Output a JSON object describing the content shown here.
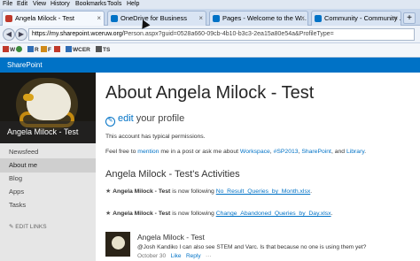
{
  "menu": [
    "File",
    "Edit",
    "View",
    "History",
    "Bookmarks",
    "Tools",
    "Help"
  ],
  "tabs": [
    {
      "label": "Angela Milock - Test",
      "active": true,
      "color": "#c0392b"
    },
    {
      "label": "OneDrive for Business",
      "active": false,
      "color": "#0072c6"
    },
    {
      "label": "Pages - Welcome to the W...",
      "active": false,
      "color": "#0072c6"
    },
    {
      "label": "Community - Community ...",
      "active": false,
      "color": "#0072c6"
    }
  ],
  "newtab_label": "+",
  "url_host": "https://my.sharepoint.wceruw.org/",
  "url_path": "Person.aspx?guid=0528a660-09cb-4b10-b3c3-2ea15a80e54a&ProfileType=",
  "bookmarks": [
    "W",
    "R",
    "F",
    "WCER",
    "TS"
  ],
  "suite_title": "SharePoint",
  "sidebar": {
    "name": "Angela Milock - Test",
    "items": [
      {
        "label": "Newsfeed",
        "selected": false
      },
      {
        "label": "About me",
        "selected": true
      },
      {
        "label": "Blog",
        "selected": false
      },
      {
        "label": "Apps",
        "selected": false
      },
      {
        "label": "Tasks",
        "selected": false
      }
    ],
    "edit_links": "EDIT LINKS"
  },
  "main": {
    "title": "About Angela Milock - Test",
    "edit_link": "edit",
    "edit_suffix": " your profile",
    "permissions": "This account has typical permissions.",
    "mention_pre": "Feel free to ",
    "mention_link": "mention",
    "mention_mid": " me in a post or ask me about ",
    "topic1": "Workspace",
    "topic2": "#SP2013",
    "topic3": "SharePoint",
    "and_text": ", and ",
    "topic4": "Library",
    "activities_heading": "Angela Milock - Test's Activities",
    "activities": [
      {
        "who": "Angela Milock - Test",
        "verb": " is now following ",
        "target": "No_Result_Queries_by_Month.xlsx",
        "end": "."
      },
      {
        "who": "Angela Milock - Test",
        "verb": " is now following ",
        "target": "Change_Abandoned_Queries_by_Day.xlsx",
        "end": "."
      }
    ],
    "post": {
      "name": "Angela Milock - Test",
      "message": "@Josh Kandiko I can also see STEM and Varc. Is that because no one is using them yet?",
      "date": "October 30",
      "like": "Like",
      "reply": "Reply",
      "more": "···"
    }
  }
}
